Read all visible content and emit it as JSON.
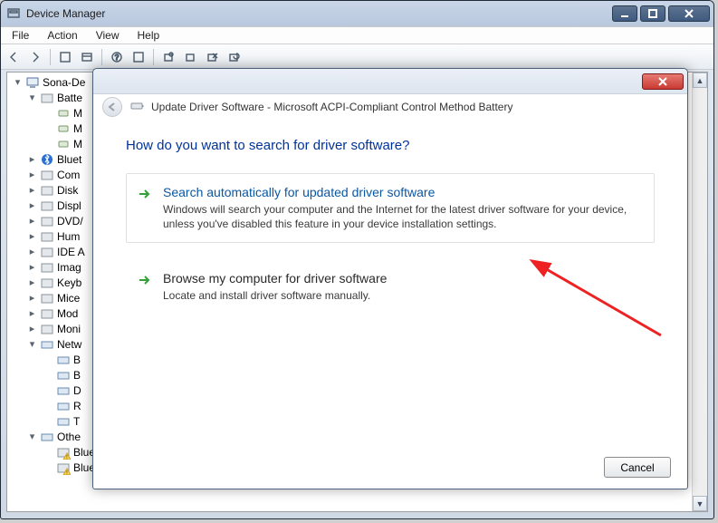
{
  "window": {
    "title": "Device Manager",
    "menus": [
      "File",
      "Action",
      "View",
      "Help"
    ]
  },
  "tree": {
    "root": "Sona-De",
    "items": [
      {
        "label": "Batte",
        "expanded": true,
        "children": [
          "M",
          "M",
          "M"
        ]
      },
      {
        "label": "Bluet"
      },
      {
        "label": "Com"
      },
      {
        "label": "Disk "
      },
      {
        "label": "Displ"
      },
      {
        "label": "DVD/"
      },
      {
        "label": "Hum"
      },
      {
        "label": "IDE A"
      },
      {
        "label": "Imag"
      },
      {
        "label": "Keyb"
      },
      {
        "label": "Mice"
      },
      {
        "label": "Mod"
      },
      {
        "label": "Moni"
      },
      {
        "label": "Netw",
        "expanded": true,
        "children": [
          "B",
          "B",
          "D",
          "R",
          "T"
        ]
      },
      {
        "label": "Othe",
        "expanded": true,
        "children": [
          "Bluetooth Peripheral Device",
          "Bluetooth Peripheral Device"
        ]
      }
    ]
  },
  "modal": {
    "title": "Update Driver Software - Microsoft ACPI-Compliant Control Method Battery",
    "heading": "How do you want to search for driver software?",
    "option1": {
      "title": "Search automatically for updated driver software",
      "desc": "Windows will search your computer and the Internet for the latest driver software for your device, unless you've disabled this feature in your device installation settings."
    },
    "option2": {
      "title": "Browse my computer for driver software",
      "desc": "Locate and install driver software manually."
    },
    "cancel": "Cancel"
  }
}
